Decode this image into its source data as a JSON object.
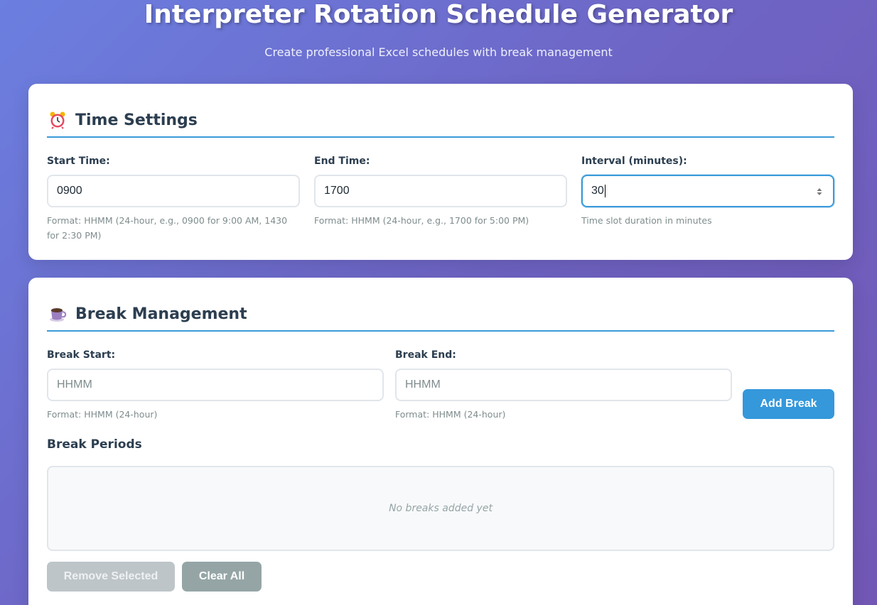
{
  "header": {
    "title": "Interpreter Rotation Schedule Generator",
    "subtitle": "Create professional Excel schedules with break management"
  },
  "time_settings": {
    "title": "Time Settings",
    "icon": "alarm-clock-icon",
    "start": {
      "label": "Start Time:",
      "value": "0900",
      "hint": "Format: HHMM (24-hour, e.g., 0900 for 9:00 AM, 1430 for 2:30 PM)"
    },
    "end": {
      "label": "End Time:",
      "value": "1700",
      "hint": "Format: HHMM (24-hour, e.g., 1700 for 5:00 PM)"
    },
    "interval": {
      "label": "Interval (minutes):",
      "value": "30",
      "hint": "Time slot duration in minutes"
    }
  },
  "break_management": {
    "title": "Break Management",
    "icon": "coffee-cup-icon",
    "break_start": {
      "label": "Break Start:",
      "placeholder": "HHMM",
      "hint": "Format: HHMM (24-hour)"
    },
    "break_end": {
      "label": "Break End:",
      "placeholder": "HHMM",
      "hint": "Format: HHMM (24-hour)"
    },
    "add_button": "Add Break",
    "periods_heading": "Break Periods",
    "empty_message": "No breaks added yet",
    "remove_button": "Remove Selected",
    "clear_button": "Clear All"
  },
  "colors": {
    "accent": "#3498db",
    "heading": "#2c3e50",
    "hint": "#7f8c8d",
    "disabled_button": "#bdc5c9",
    "secondary_button": "#95a5a6"
  }
}
